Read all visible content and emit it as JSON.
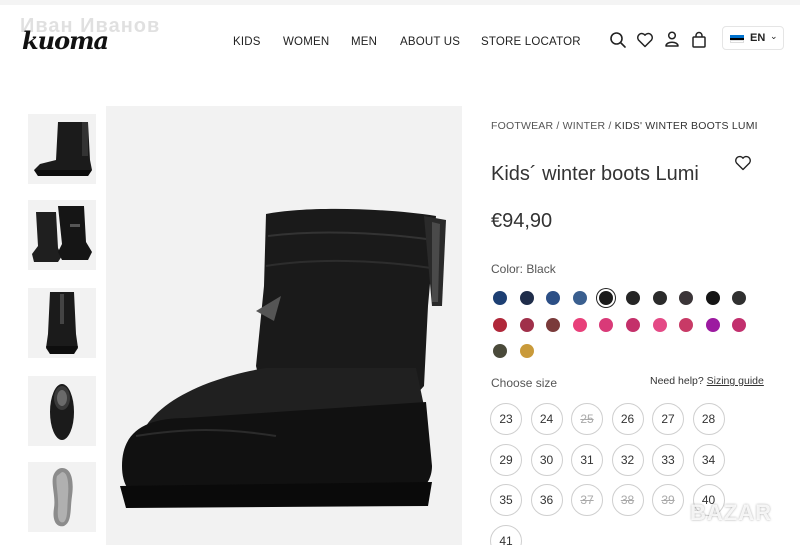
{
  "header": {
    "logo": "kuoma",
    "watermark": "Иван Иванов",
    "nav": [
      "KIDS",
      "WOMEN",
      "MEN",
      "ABOUT US",
      "STORE LOCATOR"
    ],
    "icons": [
      "search-icon",
      "heart-icon",
      "user-icon",
      "bag-icon"
    ],
    "language": {
      "code": "EN",
      "flag_colors": [
        "#0072ce",
        "#000000",
        "#ffffff"
      ]
    }
  },
  "gallery": {
    "thumbnails": [
      "boot-side-view",
      "boot-pair-view",
      "boot-back-view",
      "boot-top-view",
      "boot-sole-view"
    ],
    "main_image": "boot-side-view"
  },
  "product": {
    "breadcrumb": [
      "FOOTWEAR",
      "WINTER",
      "KIDS' WINTER BOOTS LUMI"
    ],
    "breadcrumb_sep": "/",
    "title": "Kids´ winter boots Lumi",
    "price": "€94,90",
    "color_label": "Color: Black",
    "swatches_row1": [
      "#1d3f73",
      "#1f2d4a",
      "#2c4f86",
      "#3a5f8f",
      "#1a1a1a",
      "#262626",
      "#2b2b2b",
      "#3b3538",
      "#151515",
      "#303030"
    ],
    "swatches_row2": [
      "#b0283a",
      "#a0304a",
      "#7a3a3a",
      "#e8407a",
      "#d93a78",
      "#c4306a",
      "#e44a86",
      "#c83a66",
      "#9c1aa0",
      "#c2306e"
    ],
    "swatches_row3": [
      "#4a4a3a",
      "#c99a3a"
    ],
    "selected_color_index": 4,
    "size_label": "Choose size",
    "help_text": "Need help?",
    "sizing_guide": "Sizing guide",
    "sizes": [
      {
        "v": "23",
        "a": true
      },
      {
        "v": "24",
        "a": true
      },
      {
        "v": "25",
        "a": false
      },
      {
        "v": "26",
        "a": true
      },
      {
        "v": "27",
        "a": true
      },
      {
        "v": "28",
        "a": true
      },
      {
        "v": "29",
        "a": true
      },
      {
        "v": "30",
        "a": true
      },
      {
        "v": "31",
        "a": true
      },
      {
        "v": "32",
        "a": true
      },
      {
        "v": "33",
        "a": true
      },
      {
        "v": "34",
        "a": true
      },
      {
        "v": "35",
        "a": true
      },
      {
        "v": "36",
        "a": true
      },
      {
        "v": "37",
        "a": false
      },
      {
        "v": "38",
        "a": false
      },
      {
        "v": "39",
        "a": false
      },
      {
        "v": "40",
        "a": true
      },
      {
        "v": "41",
        "a": true
      }
    ]
  },
  "watermark_corner": "BAZAR"
}
